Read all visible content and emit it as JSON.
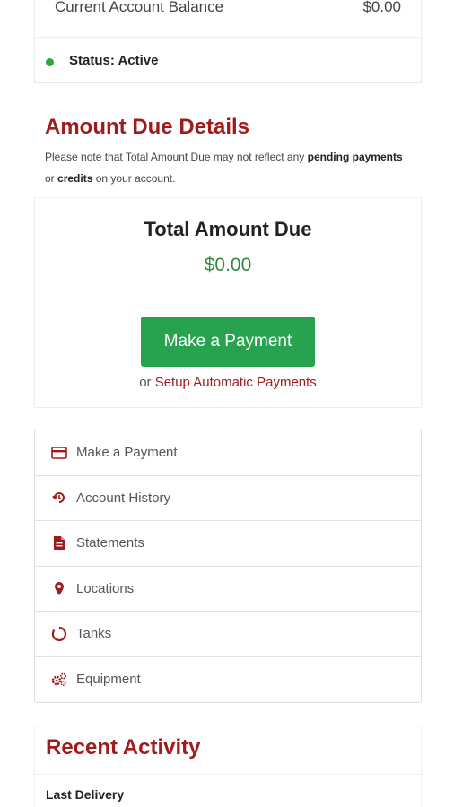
{
  "account": {
    "balance_label": "Current Account Balance",
    "balance_value": "$0.00",
    "status_text": "Status: Active",
    "status_color": "#28a745"
  },
  "due_details": {
    "title": "Amount Due Details",
    "note_part1": "Please note that Total Amount Due may not reflect any ",
    "note_bold1": "pending payments",
    "note_part2": " or ",
    "note_bold2": "credits",
    "note_part3": " on your account."
  },
  "due_card": {
    "title": "Total Amount Due",
    "amount": "$0.00",
    "pay_button_label": "Make a Payment",
    "or_text": "or ",
    "auto_pay_link": "Setup Automatic Payments"
  },
  "menu": {
    "items": [
      {
        "label": "Make a Payment",
        "icon": "credit-card-icon"
      },
      {
        "label": "Account History",
        "icon": "history-icon"
      },
      {
        "label": "Statements",
        "icon": "document-icon"
      },
      {
        "label": "Locations",
        "icon": "map-pin-icon"
      },
      {
        "label": "Tanks",
        "icon": "tank-gauge-icon"
      },
      {
        "label": "Equipment",
        "icon": "gears-icon"
      }
    ]
  },
  "recent_activity": {
    "title": "Recent Activity",
    "last_delivery_label": "Last Delivery"
  },
  "colors": {
    "brand_red": "#a01c1c",
    "button_green": "#27a24f",
    "amount_green": "#2e8b3e"
  }
}
